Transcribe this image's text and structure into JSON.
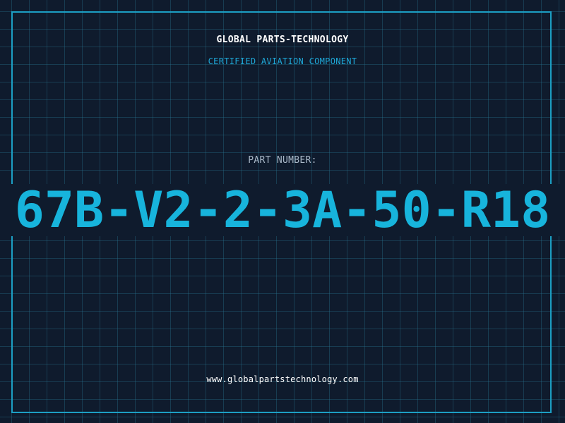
{
  "header": {
    "company": "GLOBAL PARTS-TECHNOLOGY",
    "subtitle": "CERTIFIED AVIATION COMPONENT"
  },
  "part": {
    "label": "PART NUMBER:",
    "number": "67B-V2-2-3A-50-R18"
  },
  "footer": {
    "website": "www.globalpartstechnology.com"
  },
  "colors": {
    "background": "#0f1b2d",
    "grid": "#28789a",
    "accent": "#17b4dc",
    "frame": "#1c9fc4"
  }
}
